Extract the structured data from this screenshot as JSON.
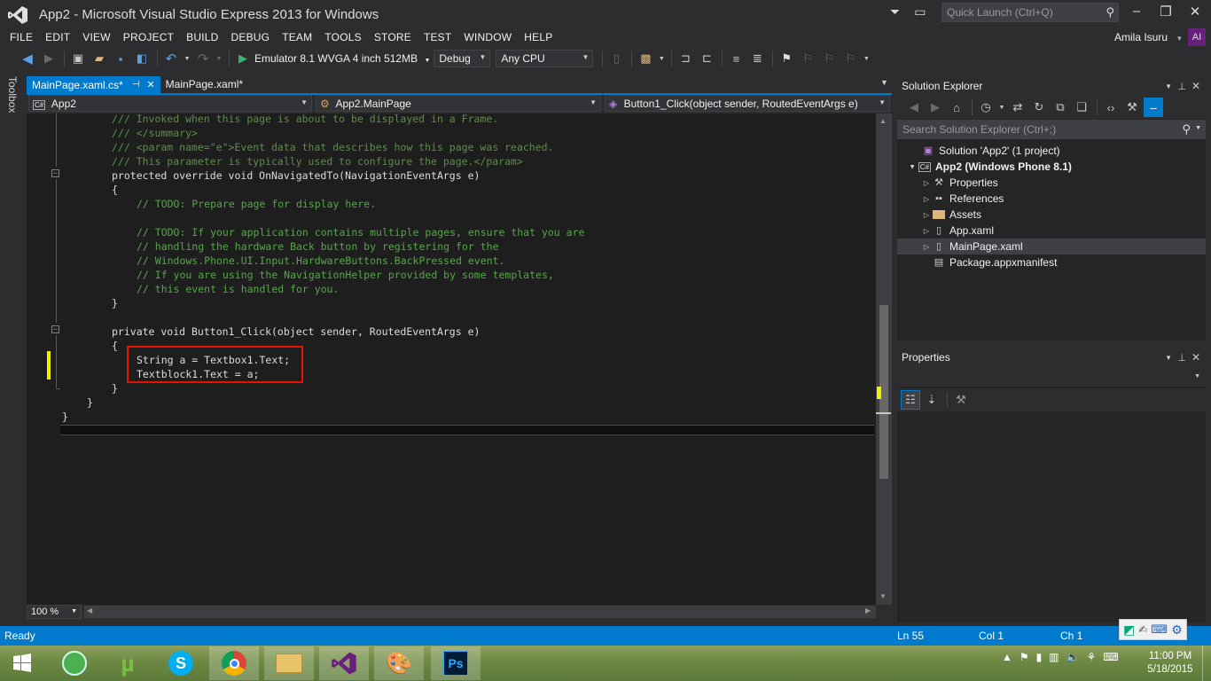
{
  "window": {
    "title": "App2 - Microsoft Visual Studio Express 2013 for Windows",
    "quick_launch_placeholder": "Quick Launch (Ctrl+Q)",
    "user_name": "Amila Isuru",
    "user_initials": "AI"
  },
  "menu": [
    "FILE",
    "EDIT",
    "VIEW",
    "PROJECT",
    "BUILD",
    "DEBUG",
    "TEAM",
    "TOOLS",
    "STORE",
    "TEST",
    "WINDOW",
    "HELP"
  ],
  "toolbar": {
    "run_target": "Emulator 8.1 WVGA 4 inch 512MB",
    "configuration": "Debug",
    "platform": "Any CPU"
  },
  "toolbox_label": "Toolbox",
  "tabs": [
    {
      "label": "MainPage.xaml.cs*",
      "active": true
    },
    {
      "label": "MainPage.xaml*",
      "active": false
    }
  ],
  "navbar": {
    "project": "App2",
    "class": "App2.MainPage",
    "member": "Button1_Click(object sender, RoutedEventArgs e)"
  },
  "code": [
    "/// Invoked when this page is about to be displayed in a Frame.",
    "/// </summary>",
    "/// <param name=\"e\">Event data that describes how this page was reached.",
    "/// This parameter is typically used to configure the page.</param>",
    "protected override void OnNavigatedTo(NavigationEventArgs e)",
    "{",
    "// TODO: Prepare page for display here.",
    "",
    "// TODO: If your application contains multiple pages, ensure that you are",
    "// handling the hardware Back button by registering for the",
    "// Windows.Phone.UI.Input.HardwareButtons.BackPressed event.",
    "// If you are using the NavigationHelper provided by some templates,",
    "// this event is handled for you.",
    "}",
    "",
    "private void Button1_Click(object sender, RoutedEventArgs e)",
    "{",
    "String a = Textbox1.Text;",
    "Textblock1.Text = a;",
    "}",
    "}",
    "}"
  ],
  "zoom": "100 %",
  "solution_explorer": {
    "title": "Solution Explorer",
    "search_placeholder": "Search Solution Explorer (Ctrl+;)",
    "tree": [
      {
        "label": "Solution 'App2' (1 project)",
        "level": 0,
        "arrow": "",
        "icon": "solution-icon",
        "bold": false,
        "selected": false
      },
      {
        "label": "App2 (Windows Phone 8.1)",
        "level": 0,
        "arrow": "▲",
        "icon": "csharp-project-icon",
        "bold": true,
        "selected": false
      },
      {
        "label": "Properties",
        "level": 1,
        "arrow": "▷",
        "icon": "wrench-icon",
        "bold": false,
        "selected": false
      },
      {
        "label": "References",
        "level": 1,
        "arrow": "▷",
        "icon": "references-icon",
        "bold": false,
        "selected": false
      },
      {
        "label": "Assets",
        "level": 1,
        "arrow": "▷",
        "icon": "folder-icon",
        "bold": false,
        "selected": false
      },
      {
        "label": "App.xaml",
        "level": 1,
        "arrow": "▷",
        "icon": "xaml-file-icon",
        "bold": false,
        "selected": false
      },
      {
        "label": "MainPage.xaml",
        "level": 1,
        "arrow": "▷",
        "icon": "xaml-file-icon",
        "bold": false,
        "selected": true
      },
      {
        "label": "Package.appxmanifest",
        "level": 1,
        "arrow": "",
        "icon": "manifest-icon",
        "bold": false,
        "selected": false
      }
    ]
  },
  "properties": {
    "title": "Properties"
  },
  "status": {
    "text": "Ready",
    "ln": "Ln 55",
    "col": "Col 1",
    "ch": "Ch 1"
  },
  "taskbar": {
    "time": "11:00 PM",
    "date": "5/18/2015"
  },
  "colors": {
    "accent": "#007acc",
    "highlight_box": "#e51400",
    "change_marker": "#efef00"
  }
}
